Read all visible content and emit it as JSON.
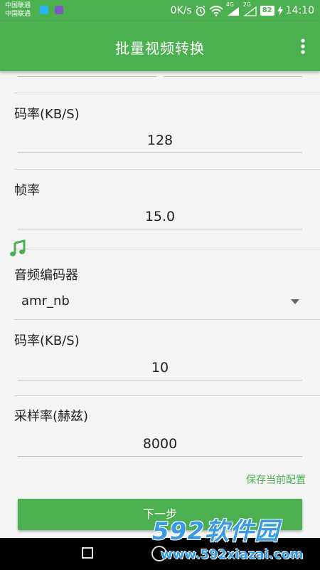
{
  "status_bar": {
    "carrier_line1": "中国联通",
    "carrier_line2": "中国联通",
    "speed": "0K/s",
    "battery": "82",
    "time": "14:10",
    "network_4g": "4G",
    "network_2g": "2G"
  },
  "header": {
    "title": "批量视频转换",
    "more_icon": "more-vert-icon"
  },
  "video": {
    "bitrate_label": "码率(KB/S)",
    "bitrate_value": "128",
    "framerate_label": "帧率",
    "framerate_value": "15.0"
  },
  "audio": {
    "section_icon": "music-note-icon",
    "encoder_label": "音频编码器",
    "encoder_value": "amr_nb",
    "bitrate_label": "码率(KB/S)",
    "bitrate_value": "10",
    "samplerate_label": "采样率(赫兹)",
    "samplerate_value": "8000"
  },
  "actions": {
    "save_config": "保存当前配置",
    "next_button": "下一步"
  },
  "watermark": {
    "logo_text": "592软件园",
    "url": "www.592xiazai.com"
  },
  "colors": {
    "primary": "#4caf50",
    "background": "#f4f4f4",
    "watermark": "#3a9be0"
  }
}
